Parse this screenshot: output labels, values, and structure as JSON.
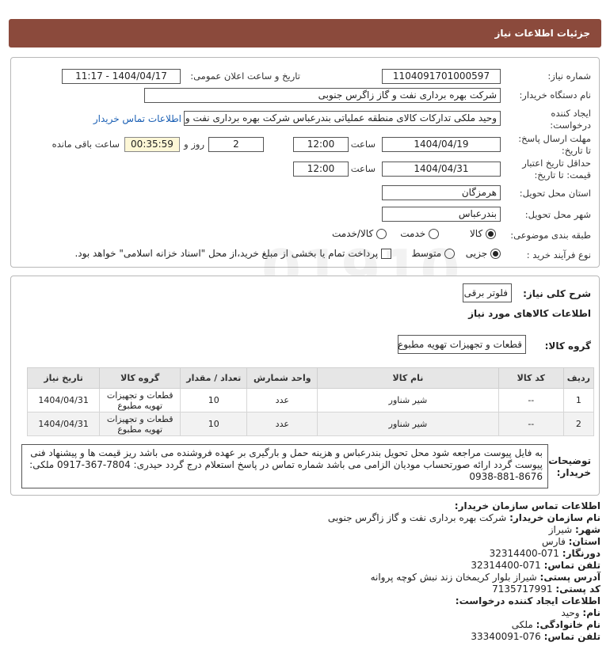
{
  "page": {
    "title": "جزئیات اطلاعات نیاز"
  },
  "form": {
    "need_number_label": "شماره نیاز:",
    "need_number": "1104091701000597",
    "announce_label": "تاریخ و ساعت اعلان عمومی:",
    "announce_value": "1404/04/17 - 11:17",
    "buyer_org_label": "نام دستگاه خریدار:",
    "buyer_org": "شرکت بهره برداری نفت و گاز زاگرس جنوبی",
    "creator_label_1": "ایجاد کننده",
    "creator_label_2": "درخواست:",
    "creator_value": "وحید ملکی تدارکات کالای منطقه عملیاتی بندرعباس شرکت بهره برداری نفت و",
    "buyer_contact_link": "اطلاعات تماس خریدار",
    "deadline_label_1": "مهلت ارسال پاسخ:",
    "deadline_label_2": "تا تاریخ:",
    "deadline_date": "1404/04/19",
    "time_label": "ساعت",
    "deadline_time": "12:00",
    "days_value": "2",
    "days_label": "روز و",
    "remaining_value": "00:35:59",
    "remaining_label": "ساعت باقی مانده",
    "validity_label_1": "حداقل تاریخ اعتبار",
    "validity_label_2": "قیمت: تا تاریخ:",
    "validity_date": "1404/04/31",
    "validity_time": "12:00",
    "province_label": "استان محل تحویل:",
    "province": "هرمزگان",
    "city_label": "شهر محل تحویل:",
    "city": "بندرعباس",
    "category_label": "طبقه بندی موضوعی:",
    "category_options": [
      "کالا",
      "خدمت",
      "کالا/خدمت"
    ],
    "category_selected": "کالا",
    "process_label": "نوع فرآیند خرید :",
    "process_options": [
      "جزیی",
      "متوسط"
    ],
    "process_selected": "جزیی",
    "payment_note": "پرداخت تمام یا بخشی از مبلغ خرید،از محل \"اسناد خزانه اسلامی\" خواهد بود."
  },
  "summary": {
    "general_desc_label": "شرح کلی نیاز:",
    "general_desc": "فلوتر برقی",
    "goods_info_title": "اطلاعات کالاهای مورد نیاز",
    "goods_group_label": "گروه کالا:",
    "goods_group": "قطعات و تجهیزات تهویه مطبوع",
    "table": {
      "headers": [
        "ردیف",
        "کد کالا",
        "نام کالا",
        "واحد شمارش",
        "تعداد / مقدار",
        "گروه کالا",
        "تاریخ نیاز"
      ],
      "rows": [
        [
          "1",
          "--",
          "شیر شناور",
          "عدد",
          "10",
          "قطعات و تجهیزات تهویه مطبوع",
          "1404/04/31"
        ],
        [
          "2",
          "--",
          "شیر شناور",
          "عدد",
          "10",
          "قطعات و تجهیزات تهویه مطبوع",
          "1404/04/31"
        ]
      ]
    },
    "buyer_notes_label_1": "توضیحات",
    "buyer_notes_label_2": "خریدار:",
    "buyer_notes": "به فایل پیوست مراجعه شود محل تحویل بندرعباس و هزینه حمل و بارگیری بر عهده فروشنده می باشد ریز قیمت ها و پیشنهاد فنی پیوست گردد ارائه صورتحساب مودیان الزامی می باشد شماره تماس در پاسخ استعلام درج گردد حیدری: 7804-367-0917 ملکی: 8676-881-0938"
  },
  "contact": {
    "section_title": "اطلاعات تماس سازمان خریدار:",
    "org_name_label": "نام سازمان خریدار:",
    "org_name": "شرکت بهره برداری نفت و گاز زاگرس جنوبی",
    "city_label": "شهر:",
    "city": "شیراز",
    "province_label": "استان:",
    "province": "فارس",
    "fax_label": "دورنگار:",
    "fax": "071-32314400",
    "phone_label": "تلفن تماس:",
    "phone": "071-32314400",
    "address_label": "آدرس پستی:",
    "address": "شیراز بلوار کریمخان زند نبش کوچه پروانه",
    "postal_label": "کد پستی:",
    "postal": "7135717991",
    "creator_title": "اطلاعات ایجاد کننده درخواست:",
    "first_name_label": "نام:",
    "first_name": "وحید",
    "last_name_label": "نام خانوادگی:",
    "last_name": "ملکی",
    "creator_phone_label": "تلفن تماس:",
    "creator_phone": "076-33340091"
  }
}
